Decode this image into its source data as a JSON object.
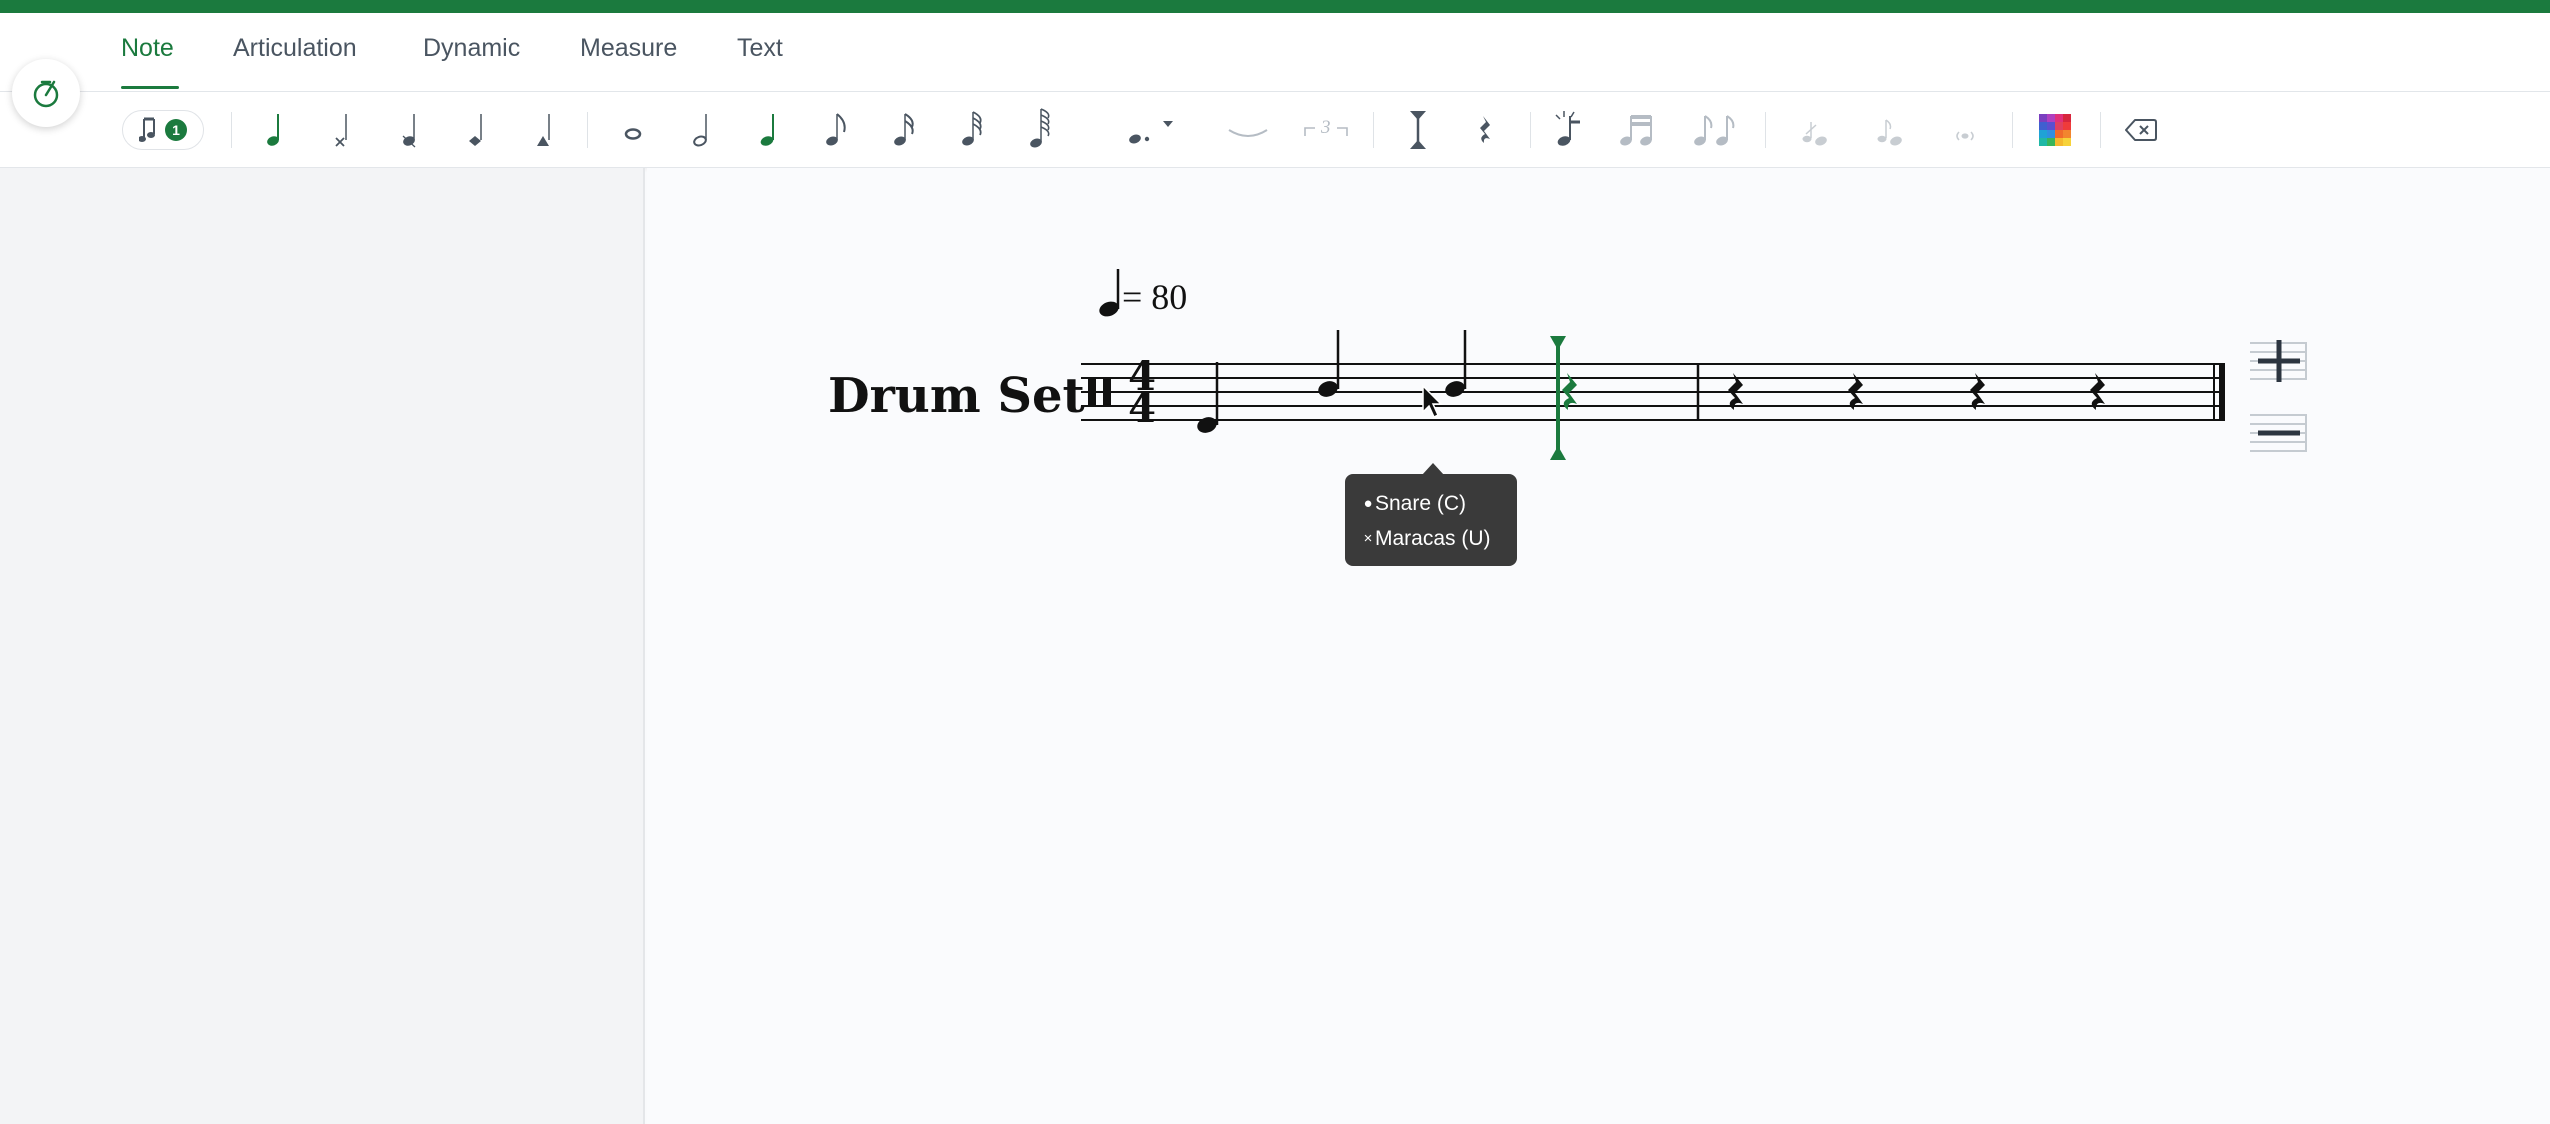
{
  "tabs": {
    "note": "Note",
    "articulation": "Articulation",
    "dynamic": "Dynamic",
    "measure": "Measure",
    "text": "Text"
  },
  "toolbar": {
    "voice_count": "1",
    "tuplet_label": "3"
  },
  "score": {
    "instrument": "Drum Set",
    "tempo_text": "= 80",
    "time_signature_top": "4",
    "time_signature_bottom": "4"
  },
  "tooltip": {
    "item1": "Snare (C)",
    "item2": "Maracas (U)"
  },
  "colors": {
    "accent": "#1b7a3e",
    "toolbar_icon": "#4a5561",
    "disabled_icon": "#b5bcc4"
  }
}
